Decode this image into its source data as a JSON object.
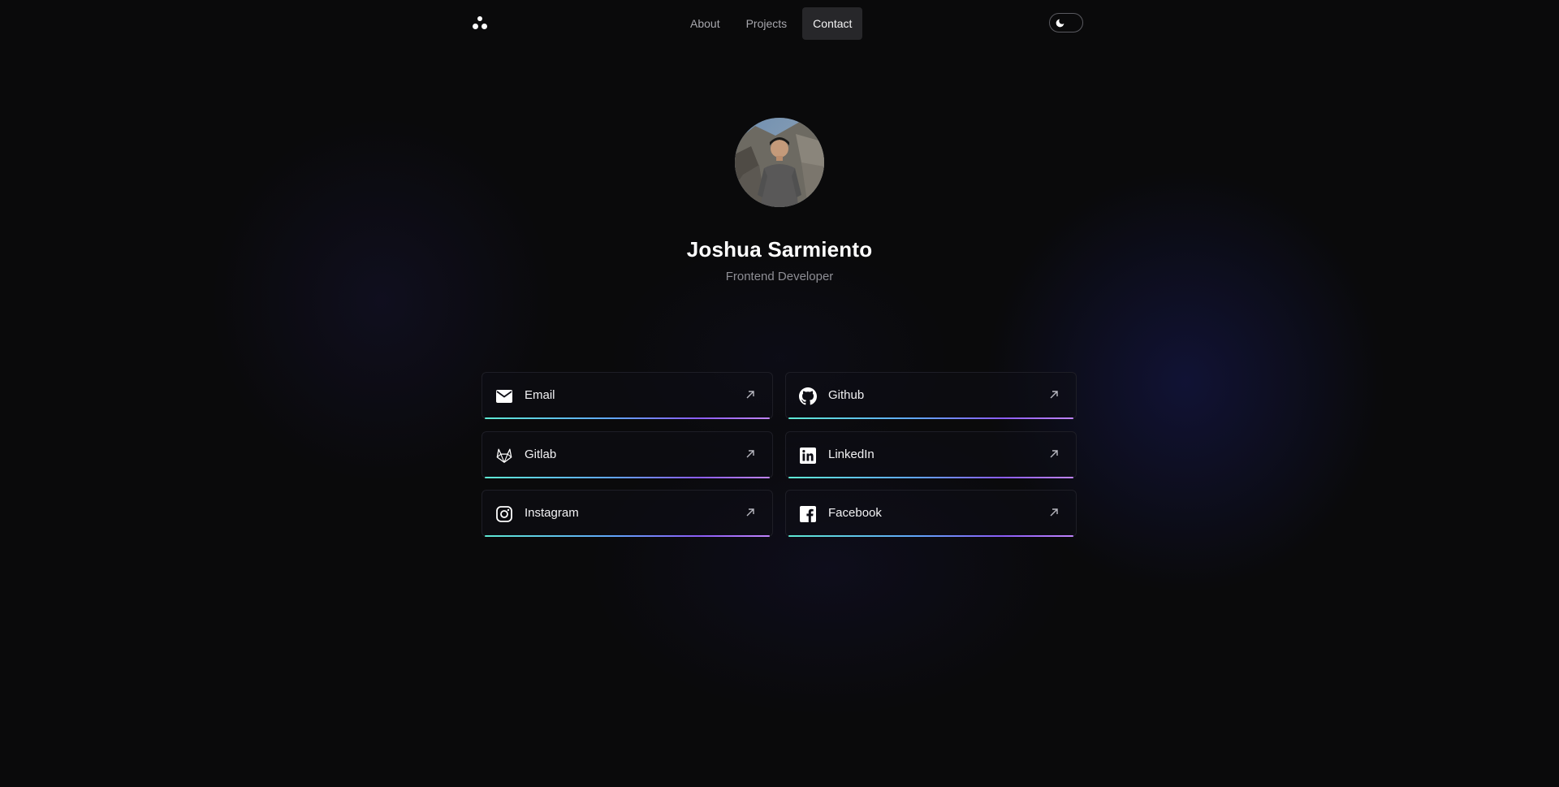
{
  "header": {
    "logo_icon": "dots-logo-icon",
    "nav": [
      {
        "label": "About",
        "active": false
      },
      {
        "label": "Projects",
        "active": false
      },
      {
        "label": "Contact",
        "active": true
      }
    ],
    "theme_toggle_icon": "moon-icon"
  },
  "profile": {
    "name": "Joshua Sarmiento",
    "role": "Frontend Developer"
  },
  "links": [
    {
      "label": "Email",
      "icon": "mail-icon"
    },
    {
      "label": "Github",
      "icon": "github-icon"
    },
    {
      "label": "Gitlab",
      "icon": "gitlab-icon"
    },
    {
      "label": "LinkedIn",
      "icon": "linkedin-icon"
    },
    {
      "label": "Instagram",
      "icon": "instagram-icon"
    },
    {
      "label": "Facebook",
      "icon": "facebook-icon"
    }
  ],
  "colors": {
    "background": "#0a0a0b",
    "nav_active_bg": "#27272a",
    "underline_gradient": [
      "#5eead4",
      "#60a5fa",
      "#8b5cf6",
      "#c084fc"
    ]
  }
}
